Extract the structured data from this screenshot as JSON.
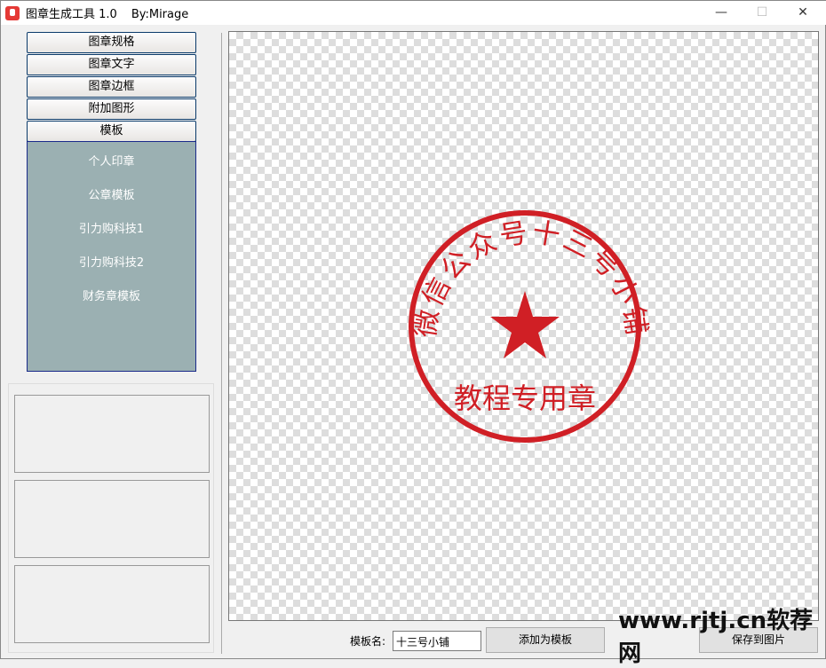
{
  "window": {
    "title": "图章生成工具 1.0",
    "author": "By:Mirage",
    "minimize": "—",
    "maximize": "☐",
    "close": "✕"
  },
  "nav": {
    "spec": "图章规格",
    "text": "图章文字",
    "border": "图章边框",
    "shape": "附加图形",
    "template": "模板"
  },
  "templates": [
    "个人印章",
    "公章模板",
    "引力购科技1",
    "引力购科技2",
    "财务章模板"
  ],
  "stamp": {
    "arc_text": "微信公众号十三号小铺",
    "center_text": "教程专用章",
    "color": "#d01f25"
  },
  "bottom": {
    "template_name_label": "模板名:",
    "template_name_value": "十三号小铺",
    "add_template": "添加为模板",
    "save_image": "保存到图片"
  },
  "watermark": "www.rjtj.cn软荐网"
}
